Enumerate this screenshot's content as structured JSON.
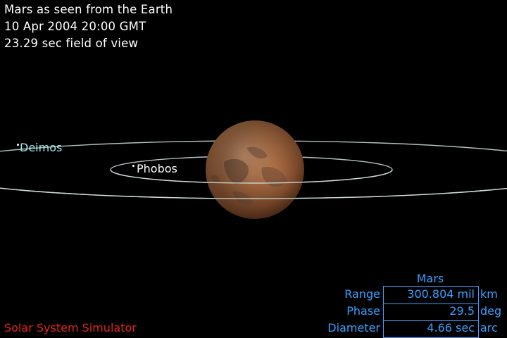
{
  "header": {
    "line1": "Mars as seen from the Earth",
    "line2": "10 Apr 2004 20:00 GMT",
    "line3": "23.29 sec field of view"
  },
  "moons": {
    "deimos": "Deimos",
    "phobos": "Phobos"
  },
  "footer": {
    "app_title": "Solar System Simulator"
  },
  "info": {
    "title": "Mars",
    "rows": [
      {
        "label": "Range",
        "value": "300.804 mil",
        "unit": "km"
      },
      {
        "label": "Phase",
        "value": "29.5",
        "unit": "deg"
      },
      {
        "label": "Diameter",
        "value": "4.66 sec",
        "unit": "arc"
      }
    ]
  },
  "colors": {
    "background": "#000000",
    "header_text": "#ffffff",
    "deimos_label": "#9fe8f0",
    "app_title": "#e0261c",
    "info_accent": "#3aa0ff",
    "orbit": "#cfe2e2",
    "mars_surface": "#b8774a"
  },
  "icons": {
    "planet": "mars-planet-icon",
    "moon_marker": "moon-dot-icon"
  }
}
